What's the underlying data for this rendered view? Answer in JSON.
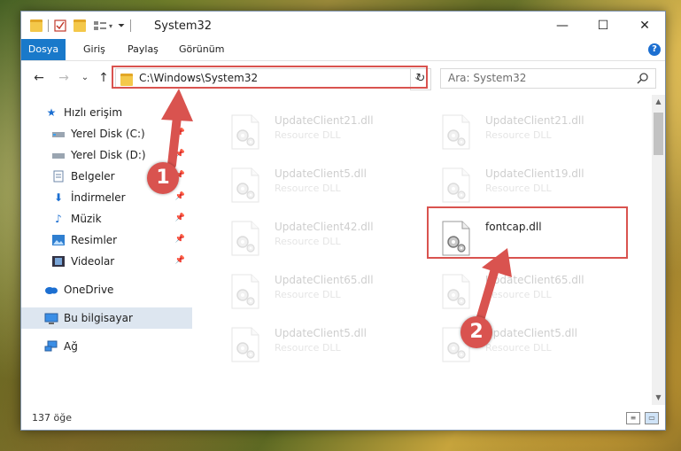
{
  "window": {
    "title": "System32"
  },
  "ribbon": {
    "tabs": [
      "Dosya",
      "Giriş",
      "Paylaş",
      "Görünüm"
    ],
    "help": "?"
  },
  "titlebar": {
    "minimize": "—",
    "maximize": "☐",
    "close": "✕"
  },
  "nav": {
    "back": "←",
    "forward": "→",
    "recent": "⌄",
    "up": "↑",
    "address": "C:\\Windows\\System32",
    "refresh": "↻",
    "search_placeholder": "Ara: System32"
  },
  "sidebar": {
    "items": [
      {
        "label": "Hızlı erişim",
        "icon": "star-icon"
      },
      {
        "label": "Yerel Disk (C:)",
        "icon": "drive-icon",
        "pinned": true
      },
      {
        "label": "Yerel Disk (D:)",
        "icon": "drive-icon",
        "pinned": true
      },
      {
        "label": "Belgeler",
        "icon": "documents-icon",
        "pinned": true
      },
      {
        "label": "İndirmeler",
        "icon": "download-icon",
        "pinned": true
      },
      {
        "label": "Müzik",
        "icon": "music-icon",
        "pinned": true
      },
      {
        "label": "Resimler",
        "icon": "pictures-icon",
        "pinned": true
      },
      {
        "label": "Videolar",
        "icon": "videos-icon",
        "pinned": true
      },
      {
        "label": "OneDrive",
        "icon": "cloud-icon"
      },
      {
        "label": "Bu bilgisayar",
        "icon": "computer-icon",
        "selected": true
      },
      {
        "label": "Ağ",
        "icon": "network-icon"
      }
    ]
  },
  "files": [
    {
      "name": "UpdateClient21.dll",
      "type": "Resource DLL",
      "faded": true
    },
    {
      "name": "UpdateClient21.dll",
      "type": "Resource DLL",
      "faded": true
    },
    {
      "name": "UpdateClient5.dll",
      "type": "Resource DLL",
      "faded": true
    },
    {
      "name": "UpdateClient19.dll",
      "type": "Resource DLL",
      "faded": true
    },
    {
      "name": "UpdateClient42.dll",
      "type": "Resource DLL",
      "faded": true
    },
    {
      "name": "fontcap.dll",
      "type": "",
      "faded": false
    },
    {
      "name": "UpdateClient65.dll",
      "type": "Resource DLL",
      "faded": true
    },
    {
      "name": "UpdateClient65.dll",
      "type": "Resource DLL",
      "faded": true
    },
    {
      "name": "UpdateClient5.dll",
      "type": "Resource DLL",
      "faded": true
    },
    {
      "name": "UpdateClient5.dll",
      "type": "Resource DLL",
      "faded": true
    }
  ],
  "status": {
    "count": "137 öğe"
  },
  "annotations": {
    "marker1": "1",
    "marker2": "2",
    "color": "#d9534f"
  }
}
